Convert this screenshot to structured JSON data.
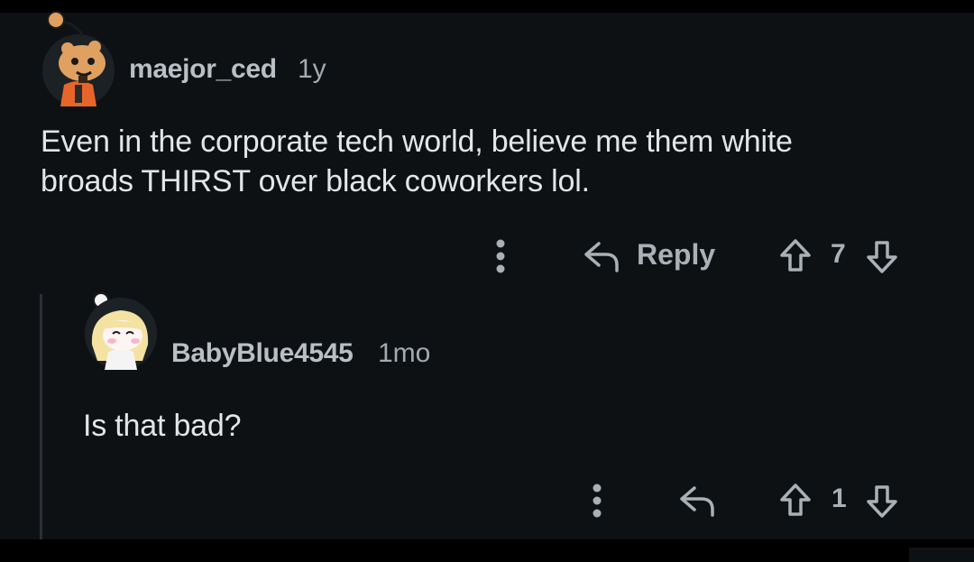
{
  "comments": [
    {
      "username": "maejor_ced",
      "age": "1y",
      "avatar_icon": "snoo-avatar-orange-jacket",
      "body": [
        "Even in the corporate tech world, believe me them white",
        "broads THIRST over black coworkers lol."
      ],
      "actions": {
        "more_icon": "more-vertical-icon",
        "reply_icon": "reply-arrow-icon",
        "reply_label": "Reply",
        "upvote_icon": "upvote-arrow-icon",
        "score": "7",
        "downvote_icon": "downvote-arrow-icon"
      }
    },
    {
      "username": "BabyBlue4545",
      "age": "1mo",
      "avatar_icon": "snoo-avatar-blonde-hair",
      "body": [
        "Is that bad?"
      ],
      "actions": {
        "more_icon": "more-vertical-icon",
        "reply_icon": "reply-arrow-icon",
        "upvote_icon": "upvote-arrow-icon",
        "score": "1",
        "downvote_icon": "downvote-arrow-icon"
      }
    }
  ],
  "colors": {
    "background": "#0e1114",
    "text_primary": "#e3e6e8",
    "text_secondary": "#a9b0b6",
    "thread_line": "#2a3036"
  }
}
